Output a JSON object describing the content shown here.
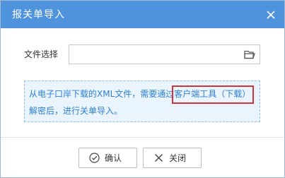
{
  "dialog": {
    "title": "报关单导入",
    "close_icon": "close-icon"
  },
  "form": {
    "file_label": "文件选择",
    "file_value": "",
    "browse_icon": "folder-icon"
  },
  "info": {
    "line1_prefix": "从电子口岸下载的XML文件，需要通过",
    "tool_text": "客户端工具（",
    "download_link": "下载",
    "tool_close": "）",
    "line2": "解密后，进行关单导入。"
  },
  "buttons": {
    "confirm_label": "确认",
    "confirm_icon": "check-circle-icon",
    "close_label": "关闭",
    "close_icon": "x-icon"
  },
  "colors": {
    "titlebar": "#4f93dc",
    "info_text": "#2f7fce",
    "info_bg": "#eaf4fd",
    "highlight": "#d0363a"
  }
}
